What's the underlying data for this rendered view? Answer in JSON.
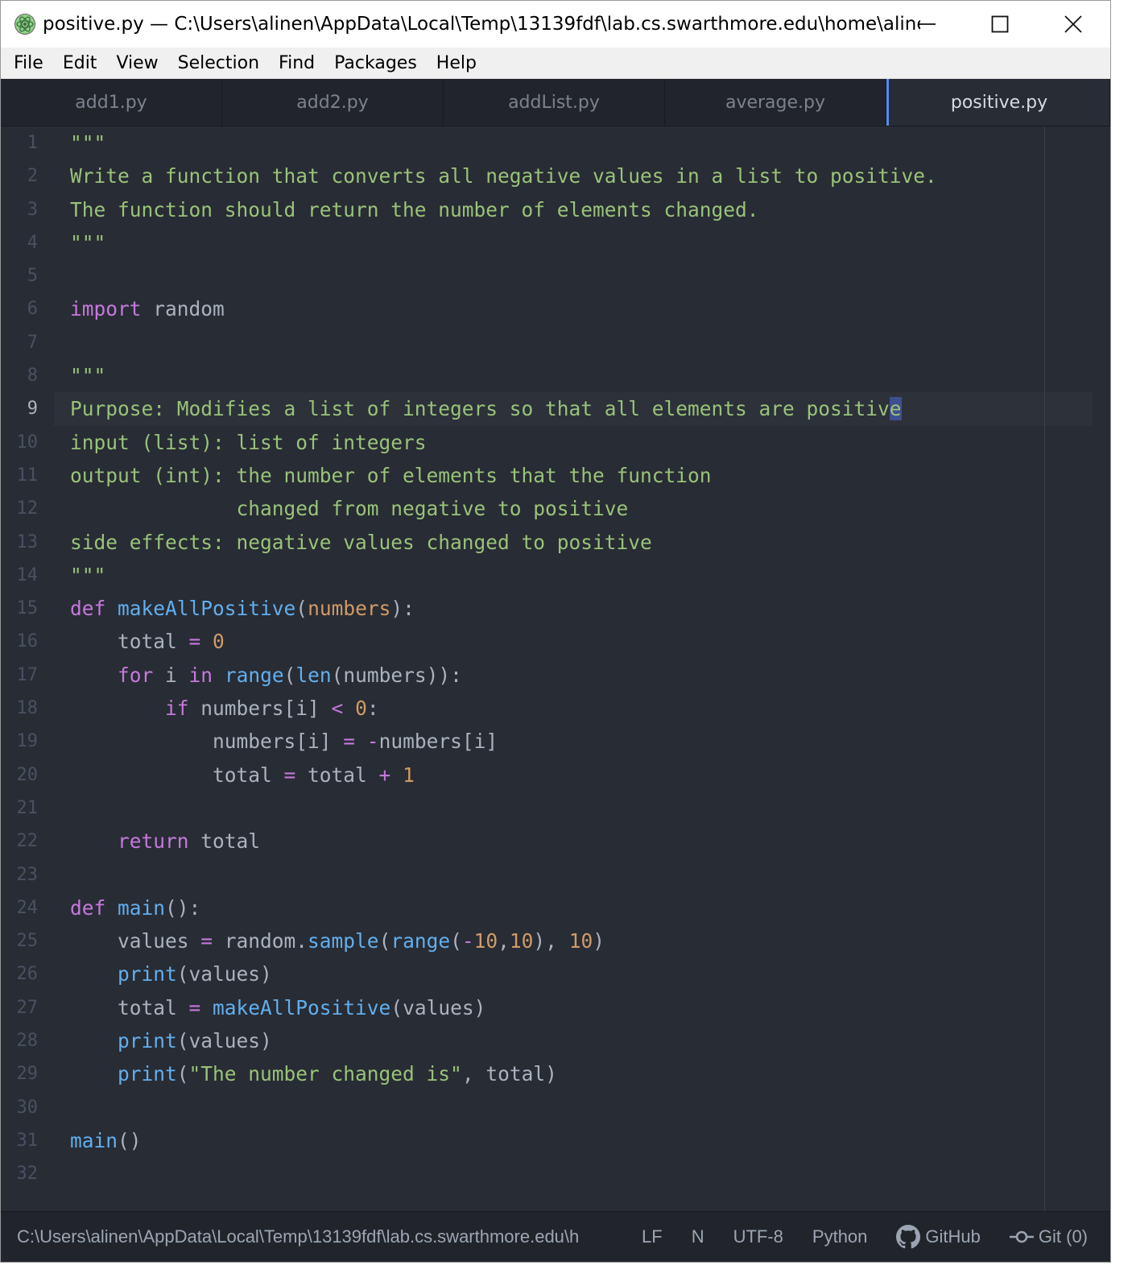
{
  "window": {
    "title": "positive.py — C:\\Users\\alinen\\AppData\\Local\\Temp\\13139fdf\\lab.cs.swarthmore.edu\\home\\alinen\\c...",
    "app_icon": "atom-icon"
  },
  "menu": [
    {
      "label": "File"
    },
    {
      "label": "Edit"
    },
    {
      "label": "View"
    },
    {
      "label": "Selection"
    },
    {
      "label": "Find"
    },
    {
      "label": "Packages"
    },
    {
      "label": "Help"
    }
  ],
  "tabs": [
    {
      "label": "add1.py",
      "active": false
    },
    {
      "label": "add2.py",
      "active": false
    },
    {
      "label": "addList.py",
      "active": false
    },
    {
      "label": "average.py",
      "active": false
    },
    {
      "label": "positive.py",
      "active": true
    }
  ],
  "editor": {
    "current_line": 9,
    "line_numbers": [
      "1",
      "2",
      "3",
      "4",
      "5",
      "6",
      "7",
      "8",
      "9",
      "10",
      "11",
      "12",
      "13",
      "14",
      "15",
      "16",
      "17",
      "18",
      "19",
      "20",
      "21",
      "22",
      "23",
      "24",
      "25",
      "26",
      "27",
      "28",
      "29",
      "30",
      "31",
      "32"
    ],
    "lines": [
      "\"\"\"",
      "Write a function that converts all negative values in a list to positive.",
      "The function should return the number of elements changed.",
      "\"\"\"",
      "",
      "import random",
      "",
      "\"\"\"",
      "Purpose: Modifies a list of integers so that all elements are positive",
      "input (list): list of integers",
      "output (int): the number of elements that the function",
      "              changed from negative to positive",
      "side effects: negative values changed to positive",
      "\"\"\"",
      "def makeAllPositive(numbers):",
      "    total = 0",
      "    for i in range(len(numbers)):",
      "        if numbers[i] < 0:",
      "            numbers[i] = -numbers[i]",
      "            total = total + 1",
      "",
      "    return total",
      "",
      "def main():",
      "    values = random.sample(range(-10,10), 10)",
      "    print(values)",
      "    total = makeAllPositive(values)",
      "    print(values)",
      "    print(\"The number changed is\", total)",
      "",
      "main()",
      ""
    ],
    "colors": {
      "string": "#98c379",
      "keyword": "#c678dd",
      "function": "#61afef",
      "number": "#d19a66",
      "text": "#abb2bf"
    }
  },
  "status": {
    "path": "C:\\Users\\alinen\\AppData\\Local\\Temp\\13139fdf\\lab.cs.swarthmore.edu\\h",
    "line_ending": "LF",
    "indent": "N",
    "encoding": "UTF-8",
    "grammar": "Python",
    "github": "GitHub",
    "git": "Git (0)"
  }
}
